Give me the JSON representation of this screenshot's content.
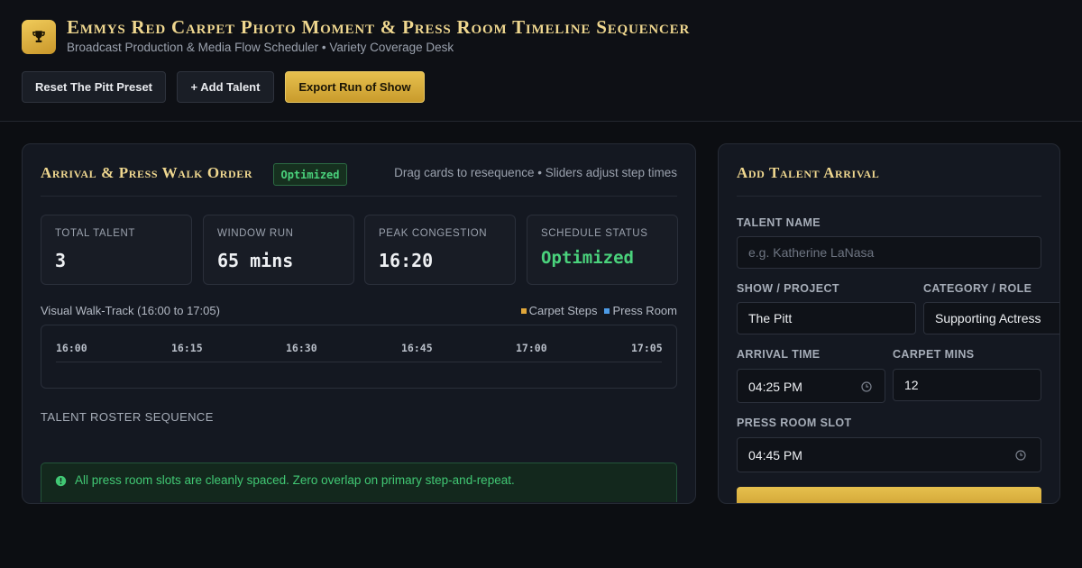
{
  "header": {
    "logo_icon": "trophy-icon",
    "title": "Emmys Red Carpet Photo Moment & Press Room Timeline Sequencer",
    "subtitle": "Broadcast Production & Media Flow Scheduler • Variety Coverage Desk",
    "buttons": {
      "reset": "Reset The Pitt Preset",
      "add": "+ Add Talent",
      "export": "Export Run of Show"
    }
  },
  "arrival_panel": {
    "title": "Arrival & Press Walk Order",
    "badge": "Optimized",
    "hint": "Drag cards to resequence • Sliders adjust step times",
    "stats": [
      {
        "label": "TOTAL TALENT",
        "value": "3"
      },
      {
        "label": "WINDOW RUN",
        "value": "65 mins"
      },
      {
        "label": "PEAK CONGESTION",
        "value": "16:20"
      },
      {
        "label": "SCHEDULE STATUS",
        "value": "Optimized"
      }
    ],
    "track": {
      "label": "Visual Walk-Track (16:00 to 17:05)",
      "legend": [
        {
          "label": "Carpet Steps",
          "color": "#e0a63a"
        },
        {
          "label": "Press Room",
          "color": "#4d9be6"
        }
      ],
      "ticks": [
        "16:00",
        "16:15",
        "16:30",
        "16:45",
        "17:00",
        "17:05"
      ]
    },
    "roster_label": "TALENT ROSTER SEQUENCE",
    "alert": {
      "icon": "alert-circle-icon",
      "text": "All press room slots are cleanly spaced. Zero overlap on primary step-and-repeat."
    }
  },
  "form_panel": {
    "title": "Add Talent Arrival",
    "talent_name": {
      "label": "TALENT NAME",
      "placeholder": "e.g. Katherine LaNasa",
      "value": ""
    },
    "show": {
      "label": "SHOW / PROJECT",
      "value": "The Pitt"
    },
    "category": {
      "label": "CATEGORY / ROLE",
      "value": "Supporting Actress"
    },
    "arrival_time": {
      "label": "ARRIVAL TIME",
      "value": "04:25 PM"
    },
    "carpet_mins": {
      "label": "CARPET MINS",
      "value": "12"
    },
    "press_slot": {
      "label": "PRESS ROOM SLOT",
      "value": "04:45 PM"
    }
  },
  "colors": {
    "gold": "#efd78f",
    "accent_gold": "#e6c04e",
    "success": "#4ad27c",
    "background": "#0c0e12"
  }
}
